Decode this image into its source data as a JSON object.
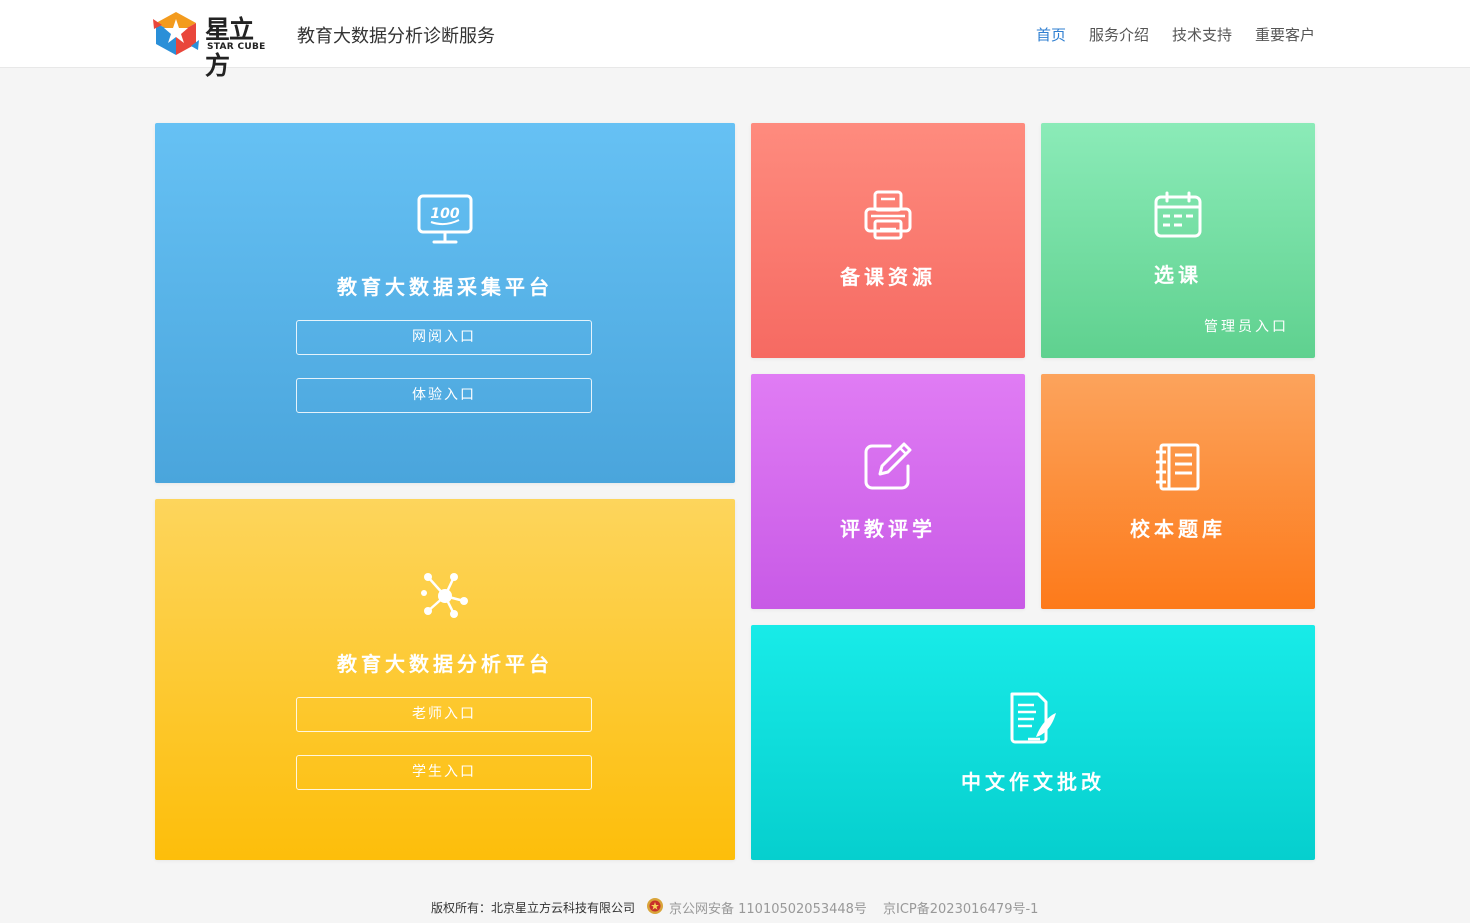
{
  "header": {
    "logo": {
      "cn": "星立方",
      "en": "STAR CUBE"
    },
    "site_title": "教育大数据分析诊断服务",
    "nav": [
      {
        "label": "首页",
        "active": true
      },
      {
        "label": "服务介绍",
        "active": false
      },
      {
        "label": "技术支持",
        "active": false
      },
      {
        "label": "重要客户",
        "active": false
      }
    ],
    "active_color": "#2f7fd1"
  },
  "tiles": {
    "collect": {
      "title": "教育大数据采集平台",
      "icon": "monitor-100-icon",
      "entries": [
        "网阅入口",
        "体验入口"
      ]
    },
    "analysis": {
      "title": "教育大数据分析平台",
      "icon": "network-nodes-icon",
      "entries": [
        "老师入口",
        "学生入口"
      ]
    },
    "prep": {
      "title": "备课资源",
      "icon": "printer-icon"
    },
    "course": {
      "title": "选课",
      "icon": "calendar-icon",
      "admin_entry": "管理员入口"
    },
    "eval": {
      "title": "评教评学",
      "icon": "edit-pen-icon"
    },
    "bank": {
      "title": "校本题库",
      "icon": "book-icon"
    },
    "essay": {
      "title": "中文作文批改",
      "icon": "document-edit-icon"
    }
  },
  "footer": {
    "copyright": "版权所有：北京星立方云科技有限公司",
    "police_record": "京公网安备 11010502053448号",
    "icp_record": "京ICP备2023016479号-1"
  }
}
